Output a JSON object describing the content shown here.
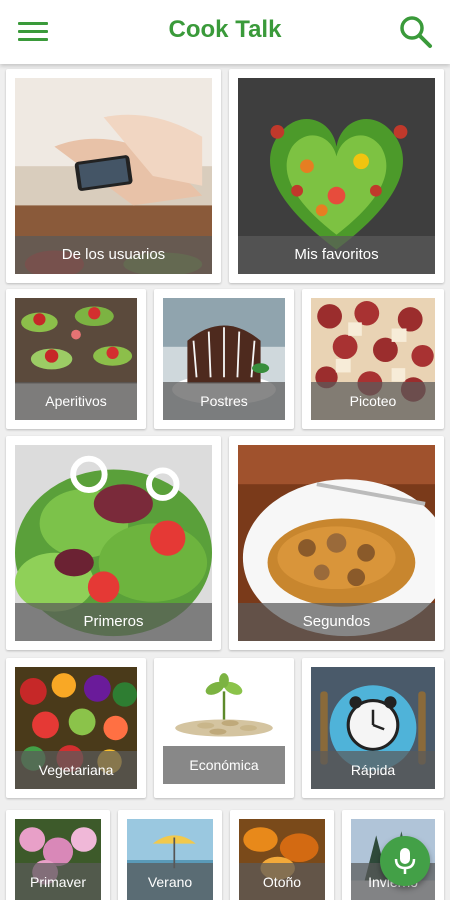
{
  "app": {
    "title": "Cook Talk"
  },
  "icons": {
    "menu": "menu-icon",
    "search": "search-icon",
    "mic": "microphone-icon"
  },
  "colors": {
    "brand": "#3a9a3a",
    "fab": "#43a047",
    "label_overlay": "rgba(90,90,90,0.72)"
  },
  "categories": {
    "users": "De los usuarios",
    "favorites": "Mis favoritos",
    "appetizers": "Aperitivos",
    "desserts": "Postres",
    "snacks": "Picoteo",
    "firsts": "Primeros",
    "seconds": "Segundos",
    "vegetarian": "Vegetariana",
    "economic": "Económica",
    "quick": "Rápida",
    "spring": "Primaver",
    "summer": "Verano",
    "autumn": "Otoño",
    "winter": "Invierno"
  }
}
